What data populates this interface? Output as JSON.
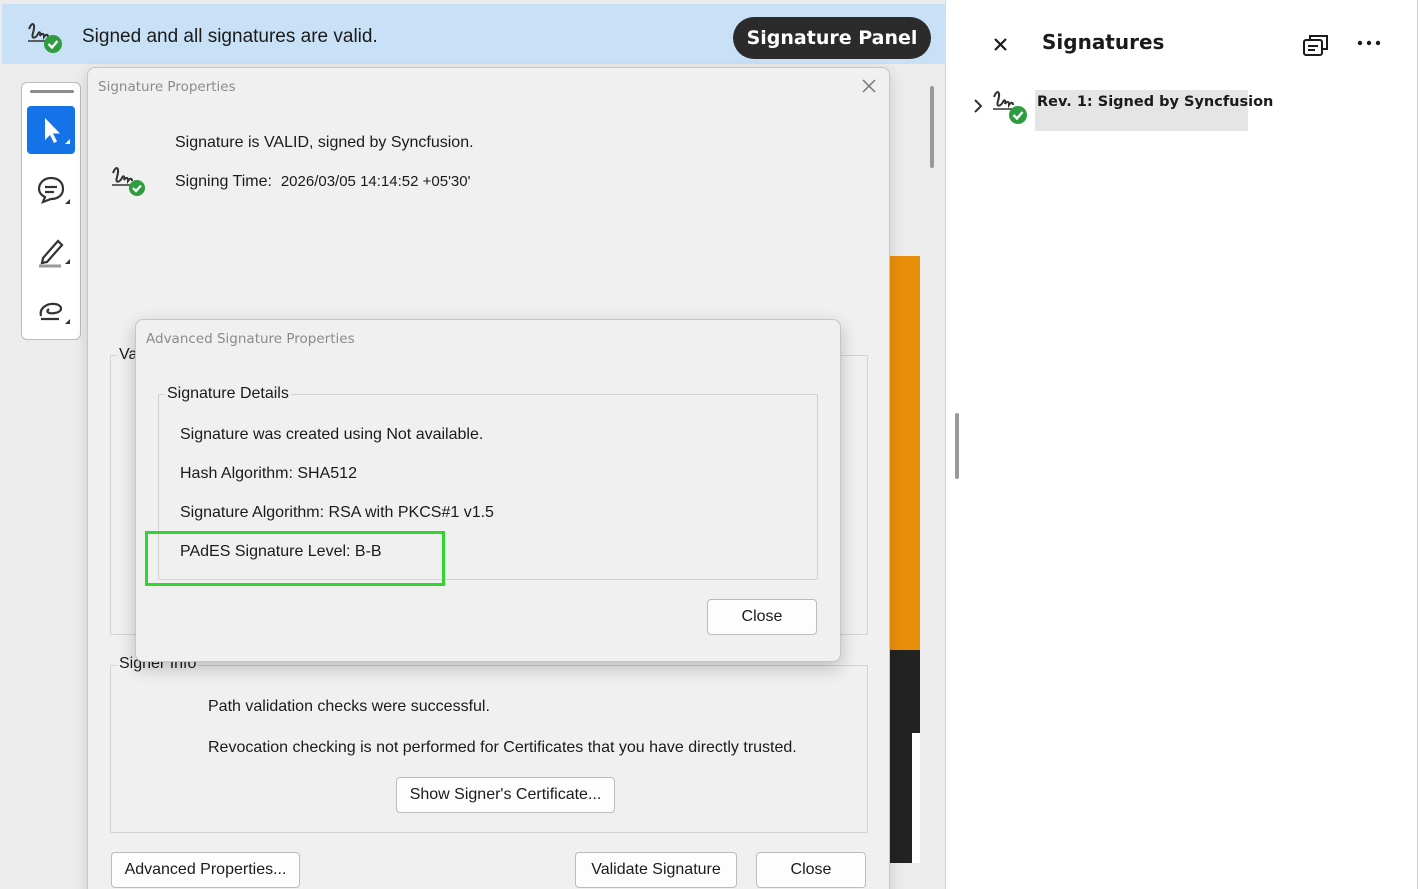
{
  "banner": {
    "message": "Signed and all signatures are valid.",
    "icon": "signature-valid-icon",
    "panel_button": "Signature Panel",
    "color": "#c9e1f6"
  },
  "toolbar": {
    "tools": [
      "select-tool",
      "comment-tool",
      "highlight-tool",
      "draw-tool"
    ],
    "active_tool": "select-tool",
    "accent": "#1473e6"
  },
  "signature_properties": {
    "title": "Signature Properties",
    "status": "Signature is VALID, signed by Syncfusion.",
    "signing_time_label": "Signing Time:",
    "signing_time_value": "2026/03/05 14:14:52 +05'30'",
    "validity_group_label": "Va",
    "signer_group_label": "Signer Info",
    "signer_lines": [
      "Path validation checks were successful.",
      "Revocation checking is not performed for Certificates that you have directly trusted."
    ],
    "show_certificate_button": "Show Signer's Certificate...",
    "advanced_button": "Advanced Properties...",
    "validate_button": "Validate Signature",
    "close_button": "Close"
  },
  "advanced_properties": {
    "title": "Advanced Signature Properties",
    "group_label": "Signature Details",
    "details": [
      "Signature was created using Not available.",
      "Hash Algorithm: SHA512",
      "Signature Algorithm: RSA with PKCS#1 v1.5",
      "PAdES Signature Level: B-B"
    ],
    "highlighted_detail": "PAdES Signature Level: B-B",
    "highlight_color": "#2fd62f",
    "close_button": "Close"
  },
  "signatures_panel": {
    "title": "Signatures",
    "items": [
      {
        "label": "Rev. 1: Signed by Syncfusion",
        "expanded": false,
        "status": "valid"
      }
    ]
  }
}
